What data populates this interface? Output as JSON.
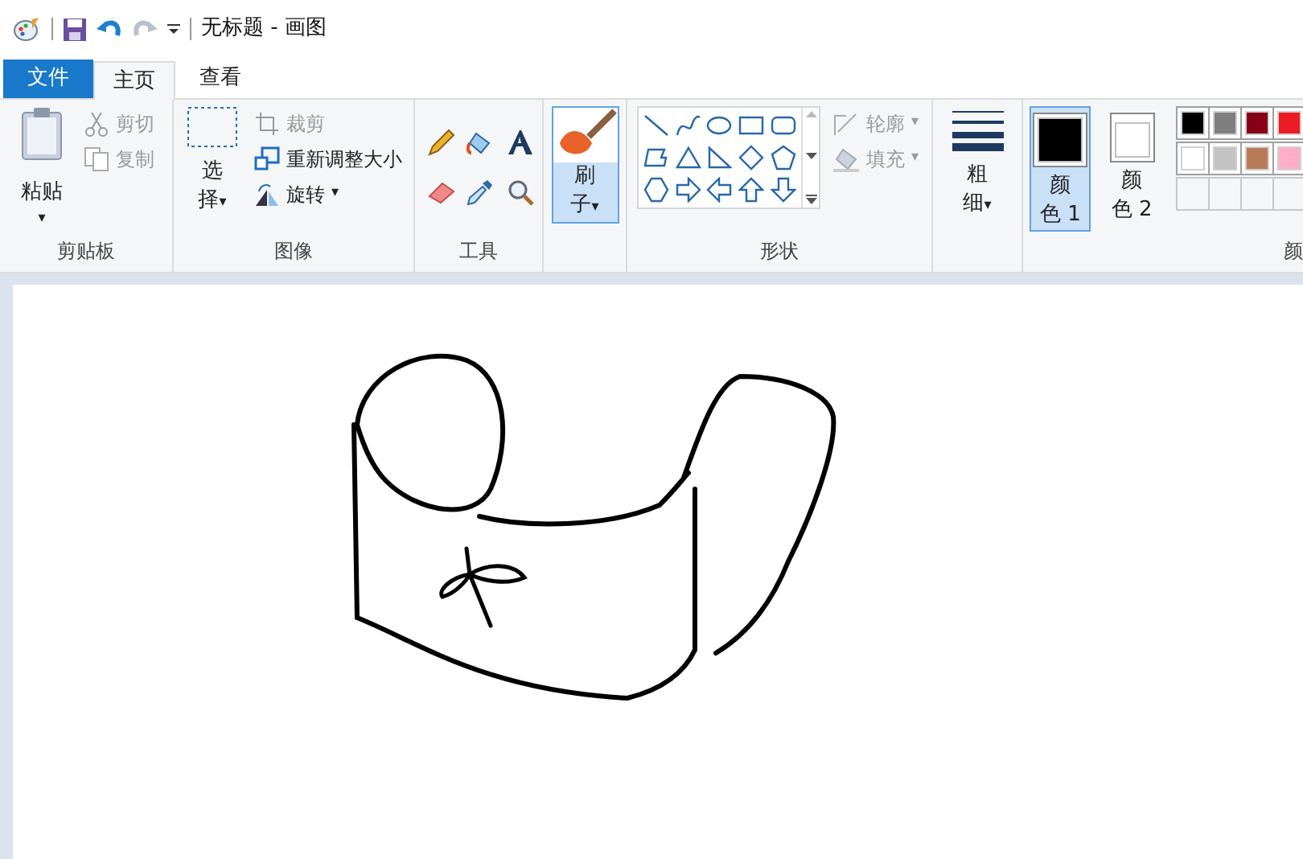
{
  "window": {
    "title": "无标题 - 画图"
  },
  "file_menu": {
    "label": "文件"
  },
  "tabs": [
    {
      "label": "主页",
      "selected": true
    },
    {
      "label": "查看",
      "selected": false
    }
  ],
  "ribbon": {
    "clipboard": {
      "label": "剪贴板",
      "paste": {
        "label": "粘贴",
        "caret": "▾"
      },
      "cut": {
        "label": "剪切",
        "disabled": true
      },
      "copy": {
        "label": "复制",
        "disabled": true
      }
    },
    "image": {
      "label": "图像",
      "select": {
        "label_1": "选",
        "label_2": "择",
        "caret": "▾"
      },
      "crop": {
        "label": "裁剪",
        "disabled": true
      },
      "resize": {
        "label": "重新调整大小",
        "disabled": false
      },
      "rotate": {
        "label": "旋转",
        "caret": "▾",
        "disabled": false
      }
    },
    "tools": {
      "label": "工具"
    },
    "brush": {
      "label_1": "刷",
      "label_2": "子",
      "caret": "▾",
      "selected": true
    },
    "shapes": {
      "label": "形状",
      "outline": {
        "label": "轮廓",
        "caret": "▾",
        "disabled": true
      },
      "fill": {
        "label": "填充",
        "caret": "▾",
        "disabled": true
      }
    },
    "size": {
      "label_1": "粗",
      "label_2": "细",
      "caret": "▾"
    },
    "color_1": {
      "label_1": "颜",
      "label_2": "色 1",
      "selected": true,
      "color": "#000000"
    },
    "color_2": {
      "label_1": "颜",
      "label_2": "色 2",
      "selected": false,
      "color": "#ffffff"
    },
    "palette": [
      {
        "color": "#000000"
      },
      {
        "color": "#7f7f7f"
      },
      {
        "color": "#880015"
      },
      {
        "color": "#ed1c24"
      },
      {
        "color": "#ffffff"
      },
      {
        "color": "#c3c3c3"
      },
      {
        "color": "#b97a57"
      },
      {
        "color": "#ffaec9"
      }
    ],
    "colors_label": "颜"
  }
}
